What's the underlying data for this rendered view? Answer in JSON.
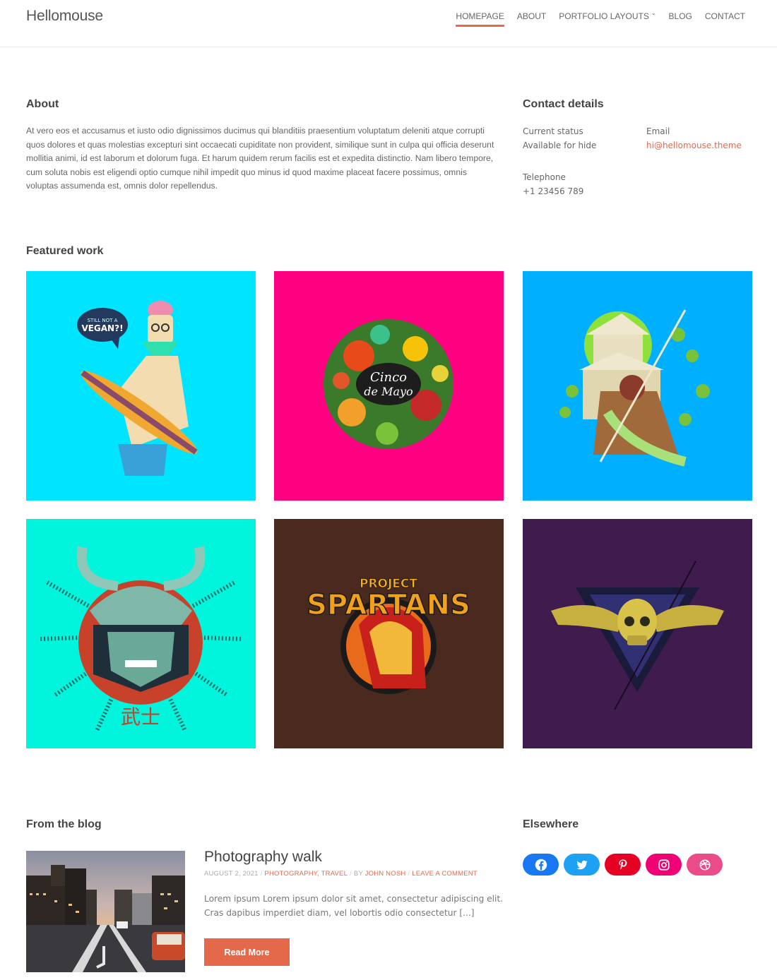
{
  "header": {
    "site_title": "Hellomouse",
    "nav": [
      {
        "label": "HOMEPAGE",
        "active": true
      },
      {
        "label": "ABOUT"
      },
      {
        "label": "PORTFOLIO LAYOUTS",
        "has_dropdown": true
      },
      {
        "label": "BLOG"
      },
      {
        "label": "CONTACT"
      }
    ]
  },
  "about": {
    "heading": "About",
    "text": "At vero eos et accusamus et iusto odio dignissimos ducimus qui blanditiis praesentium voluptatum deleniti atque corrupti quos dolores et quas molestias excepturi sint occaecati cupiditate non provident, similique sunt in culpa qui officia deserunt mollitia animi, id est laborum et dolorum fuga. Et harum quidem rerum facilis est et expedita distinctio. Nam libero tempore, cum soluta nobis est eligendi optio cumque nihil impedit quo minus id quod maxime placeat facere possimus, omnis voluptas assumenda est, omnis dolor repellendus."
  },
  "contact": {
    "heading": "Contact details",
    "status_label": "Current status",
    "status_value": "Available for hide",
    "email_label": "Email",
    "email_value": "hi@hellomouse.theme",
    "phone_label": "Telephone",
    "phone_value": "+1 23456 789"
  },
  "featured": {
    "heading": "Featured work",
    "items": [
      {
        "name": "vegan-skater",
        "bg": "#00e5ff",
        "caption_art": "STILL NOT A VEGAN?!"
      },
      {
        "name": "cinco-de-mayo",
        "bg": "#ff0080",
        "caption_art": "Cinco de Mayo"
      },
      {
        "name": "samurai-castle",
        "bg": "#00b0ff",
        "caption_art": ""
      },
      {
        "name": "samurai-mask",
        "bg": "#00f5dc",
        "caption_art": "武士"
      },
      {
        "name": "project-spartans",
        "bg": "#4a2a1e",
        "caption_art": "PROJECT SPARTANS"
      },
      {
        "name": "winged-skull",
        "bg": "#3f1c4d",
        "caption_art": ""
      }
    ]
  },
  "blog": {
    "heading": "From the blog",
    "post": {
      "title": "Photography walk",
      "date": "AUGUST 2, 2021",
      "categories": [
        "PHOTOGRAPHY",
        "TRAVEL"
      ],
      "by_label": "BY",
      "author": "JOHN NOSH",
      "comment_link": "LEAVE A COMMENT",
      "excerpt": "Lorem ipsum Lorem ipsum dolor sit amet, consectetur adipiscing elit. Cras dapibus imperdiet diam, vel lobortis odio consectetur [...]",
      "read_more": "Read More"
    }
  },
  "elsewhere": {
    "heading": "Elsewhere",
    "links": [
      {
        "icon": "facebook-icon",
        "color": "#1877f2"
      },
      {
        "icon": "twitter-icon",
        "color": "#1da1f2"
      },
      {
        "icon": "pinterest-icon",
        "color": "#e60023"
      },
      {
        "icon": "instagram-icon",
        "color": "#f00075"
      },
      {
        "icon": "dribbble-icon",
        "color": "#ea4c89"
      }
    ]
  },
  "colors": {
    "accent": "#e4694a"
  }
}
